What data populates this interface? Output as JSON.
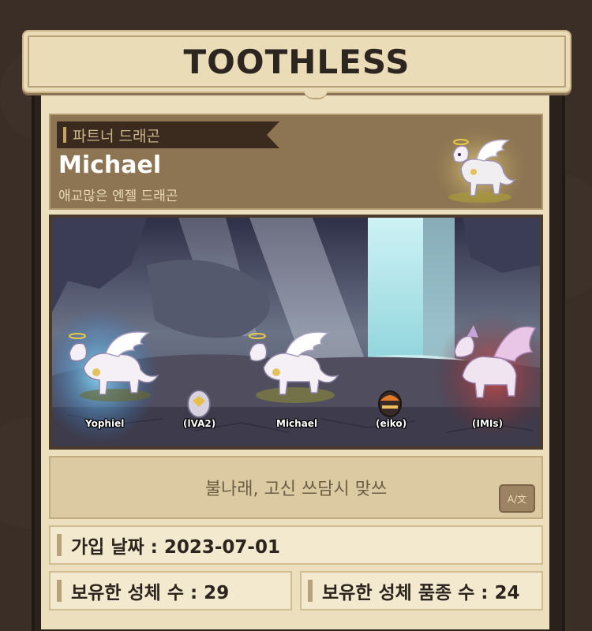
{
  "header": {
    "title": "TOOTHLESS"
  },
  "partner": {
    "tag": "파트너 드래곤",
    "name": "Michael",
    "species": "애교많은 엔젤 드래곤"
  },
  "scene": {
    "slots": [
      {
        "label": "Yophiel"
      },
      {
        "label": "(lVA2)"
      },
      {
        "label": "Michael"
      },
      {
        "label": "(eiko)"
      },
      {
        "label": "(IMIs)"
      }
    ]
  },
  "motto": {
    "text": "불나래, 고신 쓰담시 맞쓰",
    "translate_label": "A/文"
  },
  "info": {
    "join_date": "가입 날짜 : 2023-07-01",
    "creature_count": "보유한 성체 수 : 29",
    "species_count": "보유한 성체 품종 수 : 24"
  },
  "colors": {
    "background": "#3a2e26",
    "panel": "#ebdfbd",
    "partner_card": "#8d7553",
    "accent_blue_aura": "#6fd0ff",
    "accent_red_aura": "#d64040"
  }
}
